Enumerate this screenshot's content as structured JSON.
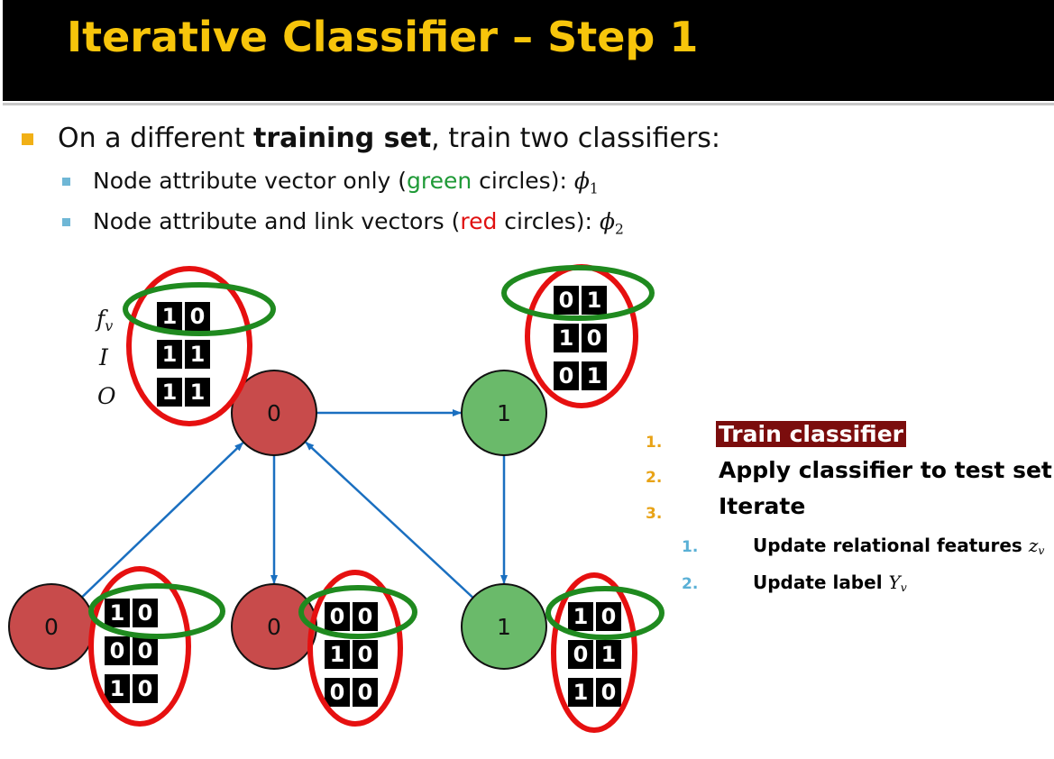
{
  "title": "Iterative Classifier – Step 1",
  "colors": {
    "title_background": "#000000",
    "title_text": "#f7c50b",
    "node_red": "#c84b4b",
    "node_green": "#6aba6a",
    "edge": "#1a6fc0",
    "ellipse_green": "#1f8a1f",
    "ellipse_red": "#e61010",
    "step_highlight": "#7b0d0d",
    "number_orange": "#e8a317",
    "number_blue": "#5ab0d6"
  },
  "bullets": {
    "main": {
      "prefix": "On a different ",
      "bold": "training set",
      "suffix": ", train two classifiers:"
    },
    "sub": [
      {
        "prefix": "Node attribute vector only (",
        "colored": "green",
        "suffix": " circles): ",
        "symbol": "ϕ",
        "subscript": "1"
      },
      {
        "prefix": "Node attribute and link vectors (",
        "colored": "red",
        "suffix": " circles): ",
        "symbol": "ϕ",
        "subscript": "2"
      }
    ]
  },
  "row_labels": {
    "fv": "f",
    "fv_sub": "v",
    "I": "I",
    "O": "O"
  },
  "nodes": [
    {
      "id": "top-left",
      "label": "0",
      "color": "red",
      "vectors": [
        "1 0",
        "1 1",
        "1 1"
      ]
    },
    {
      "id": "top-right",
      "label": "1",
      "color": "green",
      "vectors": [
        "0 1",
        "1 0",
        "0 1"
      ]
    },
    {
      "id": "bottom-left",
      "label": "0",
      "color": "red",
      "vectors": [
        "1 0",
        "0 0",
        "1 0"
      ]
    },
    {
      "id": "bottom-middle",
      "label": "0",
      "color": "red",
      "vectors": [
        "0 0",
        "1 0",
        "0 0"
      ]
    },
    {
      "id": "bottom-right",
      "label": "1",
      "color": "green",
      "vectors": [
        "1 0",
        "0 1",
        "1 0"
      ]
    }
  ],
  "edges": [
    {
      "from": "top-left",
      "to": "top-right"
    },
    {
      "from": "bottom-left",
      "to": "top-left"
    },
    {
      "from": "top-left",
      "to": "bottom-middle"
    },
    {
      "from": "bottom-right",
      "to": "top-left"
    },
    {
      "from": "top-right",
      "to": "bottom-right"
    }
  ],
  "steps": [
    {
      "number": "1.",
      "text": "Train classifier",
      "highlighted": true
    },
    {
      "number": "2.",
      "text": "Apply classifier to test set"
    },
    {
      "number": "3.",
      "text": "Iterate"
    }
  ],
  "substeps": [
    {
      "number": "1.",
      "text": "Update relational features ",
      "math": "z",
      "math_sub": "v"
    },
    {
      "number": "2.",
      "text": "Update label ",
      "math": "Y",
      "math_sub": "v"
    }
  ]
}
